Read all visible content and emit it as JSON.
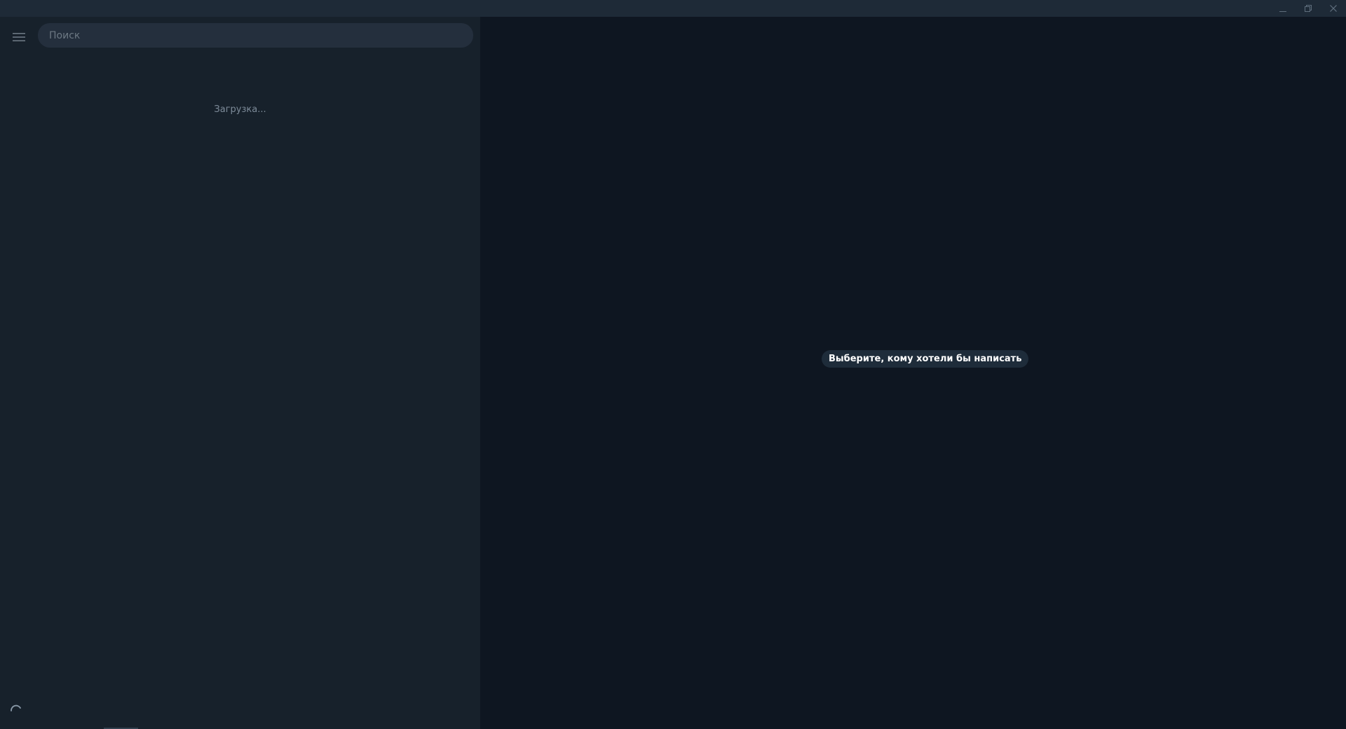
{
  "window": {
    "controls": {
      "minimize_icon": "minimize-icon",
      "restore_icon": "restore-icon",
      "close_icon": "close-icon"
    }
  },
  "sidebar": {
    "menu_icon": "hamburger-menu-icon",
    "search": {
      "placeholder": "Поиск",
      "value": ""
    },
    "loading_text": "Загрузка...",
    "spinner_icon": "loading-spinner-icon"
  },
  "main": {
    "empty_state_text": "Выберите, кому хотели бы написать"
  },
  "colors": {
    "titlebar": "#1e2a37",
    "sidebar": "#17212b",
    "main": "#0e1621",
    "search_bg": "#242f3d",
    "pill_bg": "#1e2c3a",
    "muted_text": "#7d8b99"
  }
}
